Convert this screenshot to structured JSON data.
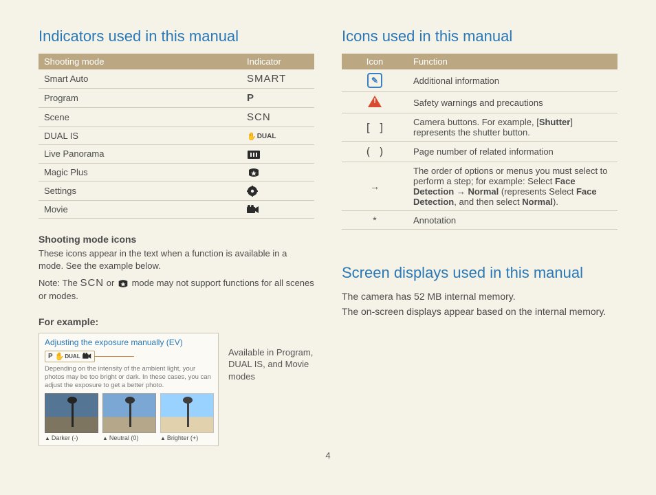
{
  "page_number": "4",
  "left": {
    "heading": "Indicators used in this manual",
    "table": {
      "col1": "Shooting mode",
      "col2": "Indicator",
      "rows": [
        {
          "mode": "Smart Auto",
          "ind": "SMART"
        },
        {
          "mode": "Program",
          "ind": "P"
        },
        {
          "mode": "Scene",
          "ind": "SCN"
        },
        {
          "mode": "DUAL IS",
          "ind": "DUAL"
        },
        {
          "mode": "Live Panorama",
          "ind": "panorama-icon"
        },
        {
          "mode": "Magic Plus",
          "ind": "magic-plus-icon"
        },
        {
          "mode": "Settings",
          "ind": "settings-icon"
        },
        {
          "mode": "Movie",
          "ind": "movie-icon"
        }
      ]
    },
    "sub_heading": "Shooting mode icons",
    "sub_p1": "These icons appear in the text when a function is available in a mode. See the example below.",
    "sub_p2a": "Note: The ",
    "sub_p2_scn": "SCN",
    "sub_p2b": " or ",
    "sub_p2c": " mode may not support functions for all scenes or modes.",
    "for_example": "For example:",
    "ex_title": "Adjusting the exposure manually (EV)",
    "ex_badge_p": "P",
    "ex_badge_dual": "DUAL",
    "ex_desc": "Depending on the intensity of the ambient light, your photos may be too bright or dark. In these cases, you can adjust the exposure to get a better photo.",
    "thumbs": [
      {
        "cap": "Darker (-)"
      },
      {
        "cap": "Neutral (0)"
      },
      {
        "cap": "Brighter (+)"
      }
    ],
    "ex_side": "Available in Program, DUAL IS, and Movie modes"
  },
  "right": {
    "heading": "Icons used in this manual",
    "table": {
      "col1": "Icon",
      "col2": "Function",
      "rows": {
        "info": "Additional information",
        "warn": "Safety warnings and precautions",
        "brackets_sym": "[  ]",
        "brackets_a": "Camera buttons. For example, [",
        "brackets_b": "Shutter",
        "brackets_c": "] represents the shutter button.",
        "paren_sym": "(  )",
        "paren": "Page number of related information",
        "arrow_sym": "→",
        "arrow_a": "The order of options or menus you must select to perform a step; for example: Select ",
        "arrow_b": "Face Detection",
        "arrow_c": " → ",
        "arrow_d": "Normal",
        "arrow_e": " (represents Select ",
        "arrow_f": "Face Detection",
        "arrow_g": ", and then select ",
        "arrow_h": "Normal",
        "arrow_i": ").",
        "star_sym": "*",
        "star": "Annotation"
      }
    },
    "screen_heading": "Screen displays used in this manual",
    "screen_p1": "The camera has 52 MB internal memory.",
    "screen_p2": "The on-screen displays appear based on the internal memory."
  }
}
